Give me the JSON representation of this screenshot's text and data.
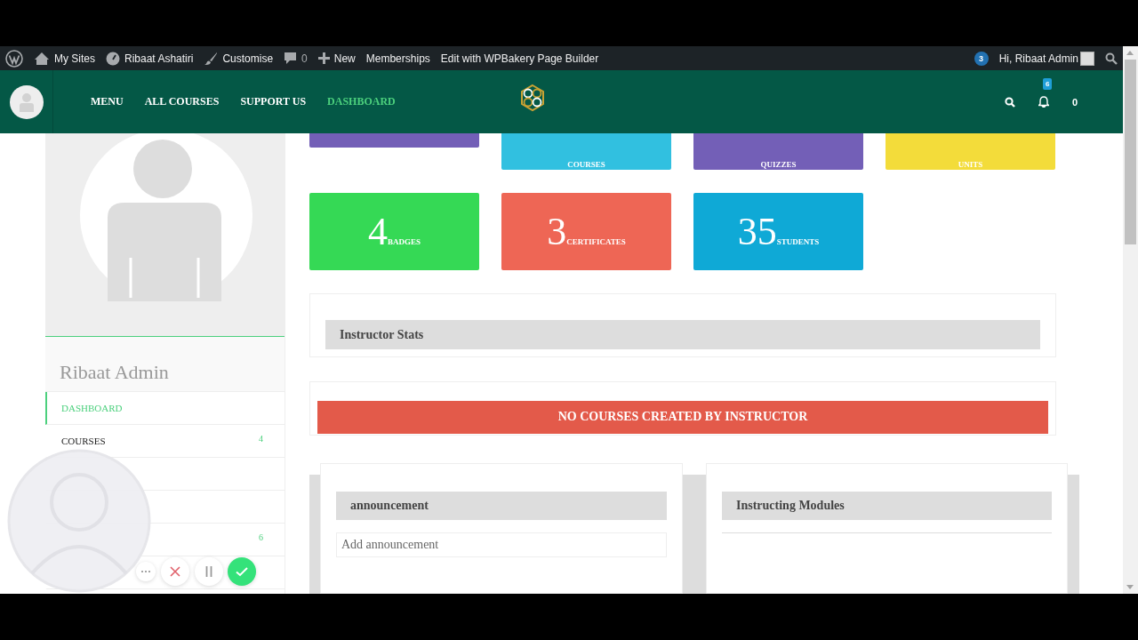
{
  "admin_bar": {
    "items": [
      {
        "kind": "wp"
      },
      {
        "kind": "sites",
        "label": "My Sites"
      },
      {
        "kind": "site",
        "label": "Ribaat Ashatiri"
      },
      {
        "kind": "customise",
        "label": "Customise"
      },
      {
        "kind": "comments",
        "label": "0"
      },
      {
        "kind": "new",
        "label": "New"
      },
      {
        "kind": "text",
        "label": "Memberships"
      },
      {
        "kind": "text",
        "label": "Edit with WPBakery Page Builder"
      }
    ],
    "updates_badge": "3",
    "greeting": "Hi, Ribaat Admin"
  },
  "header": {
    "nav": [
      {
        "label": "MENU",
        "selected": false
      },
      {
        "label": "ALL COURSES",
        "selected": false
      },
      {
        "label": "SUPPORT US",
        "selected": false
      },
      {
        "label": "DASHBOARD",
        "selected": true
      }
    ],
    "notifications_badge": "6",
    "cart_count": "0"
  },
  "sidebar": {
    "name": "Ribaat Admin",
    "items": [
      {
        "label": "DASHBOARD",
        "selected": true
      },
      {
        "label": "COURSES",
        "count": "4",
        "selected": false
      },
      {
        "kind": "covered"
      },
      {
        "kind": "covered"
      },
      {
        "kind": "covered",
        "count": "6"
      },
      {
        "kind": "covered"
      }
    ]
  },
  "stats": [
    {
      "color": "#735fb7"
    },
    {
      "label": "COURSES",
      "color": "#31c0e0"
    },
    {
      "label": "QUIZZES",
      "color": "#735fb7"
    },
    {
      "label": "UNITS",
      "color": "#f3dc3a"
    },
    {
      "number": "4",
      "label": "BADGES",
      "color": "#35d955"
    },
    {
      "number": "3",
      "label": "CERTIFICATES",
      "color": "#ee6655"
    },
    {
      "number": "35",
      "label": "STUDENTS",
      "color": "#0fa9d6"
    }
  ],
  "instructor_stats": {
    "title": "Instructor Stats"
  },
  "notice": {
    "text": "NO COURSES CREATED BY INSTRUCTOR"
  },
  "announcement": {
    "title": "announcement",
    "placeholder": "Add announcement"
  },
  "modules": {
    "title": "Instructing Modules"
  }
}
